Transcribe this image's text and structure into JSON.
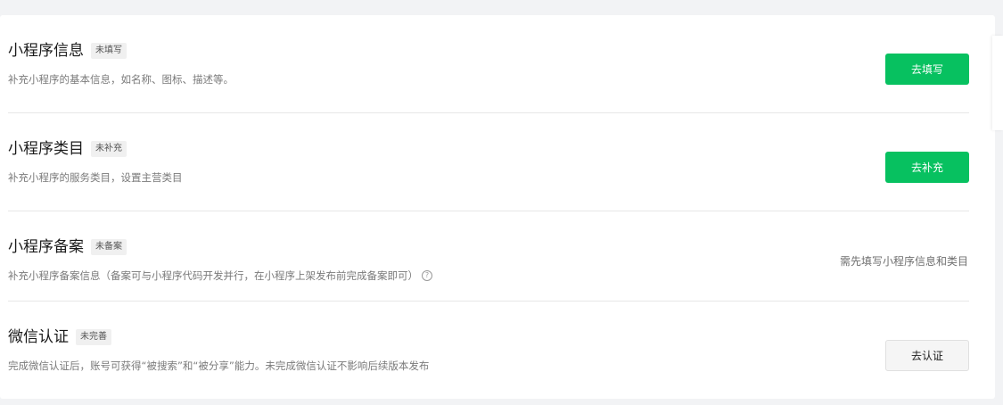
{
  "sections": [
    {
      "title": "小程序信息",
      "badge": "未填写",
      "description": "补充小程序的基本信息，如名称、图标、描述等。",
      "action_label": "去填写"
    },
    {
      "title": "小程序类目",
      "badge": "未补充",
      "description": "补充小程序的服务类目，设置主营类目",
      "action_label": "去补充"
    },
    {
      "title": "小程序备案",
      "badge": "未备案",
      "description": "补充小程序备案信息（备案可与小程序代码开发并行，在小程序上架发布前完成备案即可）",
      "help_icon": "question-circle-icon",
      "status_note": "需先填写小程序信息和类目"
    },
    {
      "title": "微信认证",
      "badge": "未完善",
      "description": "完成微信认证后，账号可获得“被搜索”和“被分享”能力。未完成微信认证不影响后续版本发布",
      "action_label": "去认证"
    }
  ],
  "colors": {
    "primary": "#07c160",
    "page_background": "#f2f3f5",
    "card_background": "#ffffff"
  }
}
